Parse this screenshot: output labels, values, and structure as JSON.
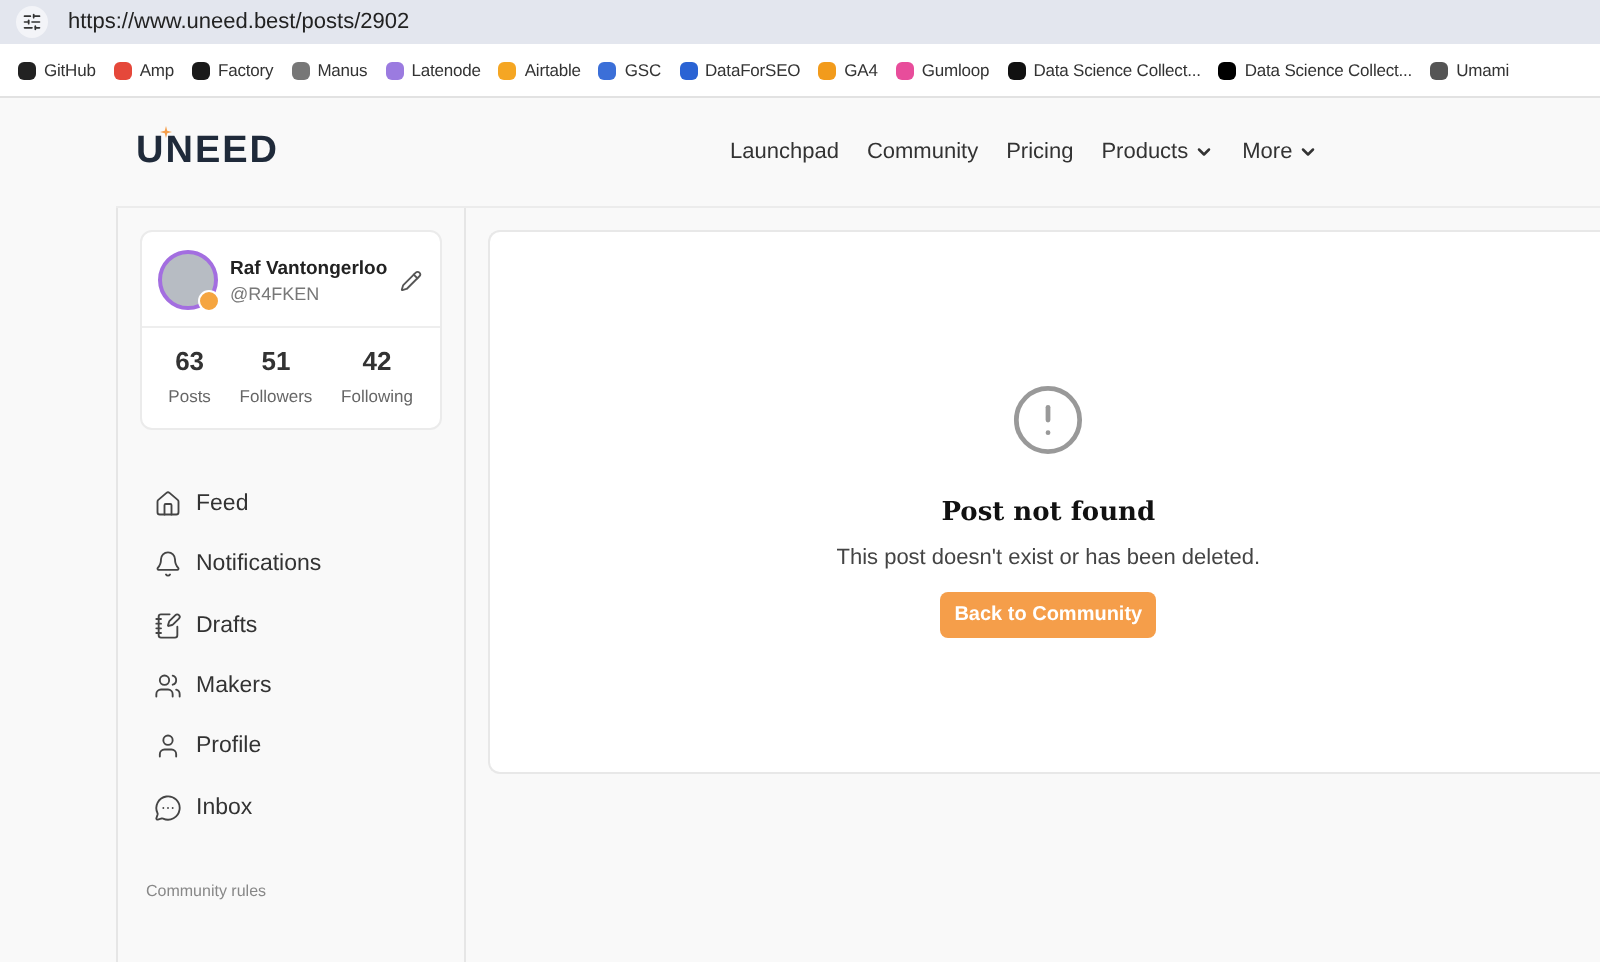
{
  "browser": {
    "url": "https://www.uneed.best/posts/2902"
  },
  "bookmarks": [
    {
      "label": "GitHub",
      "color": "#222222"
    },
    {
      "label": "Amp",
      "color": "#e5483a"
    },
    {
      "label": "Factory",
      "color": "#1a1a1a"
    },
    {
      "label": "Manus",
      "color": "#777777"
    },
    {
      "label": "Latenode",
      "color": "#9b7be0"
    },
    {
      "label": "Airtable",
      "color": "#f5a623"
    },
    {
      "label": "GSC",
      "color": "#3b6fd8"
    },
    {
      "label": "DataForSEO",
      "color": "#2a63d4"
    },
    {
      "label": "GA4",
      "color": "#f29b1c"
    },
    {
      "label": "Gumloop",
      "color": "#e84d9b"
    },
    {
      "label": "Data Science Collect...",
      "color": "#111111"
    },
    {
      "label": "Data Science Collect...",
      "color": "#000000"
    },
    {
      "label": "Umami",
      "color": "#555555"
    }
  ],
  "logo": "UNEED",
  "nav": [
    {
      "label": "Launchpad",
      "dropdown": false
    },
    {
      "label": "Community",
      "dropdown": false
    },
    {
      "label": "Pricing",
      "dropdown": false
    },
    {
      "label": "Products",
      "dropdown": true
    },
    {
      "label": "More",
      "dropdown": true
    }
  ],
  "profile": {
    "name": "Raf Vantongerloo",
    "handle": "@R4FKEN",
    "stats": [
      {
        "value": "63",
        "label": "Posts"
      },
      {
        "value": "51",
        "label": "Followers"
      },
      {
        "value": "42",
        "label": "Following"
      }
    ]
  },
  "sidebar": {
    "items": [
      {
        "label": "Feed",
        "kind": "home"
      },
      {
        "label": "Notifications",
        "kind": "bell"
      },
      {
        "label": "Drafts",
        "kind": "drafts"
      },
      {
        "label": "Makers",
        "kind": "users"
      },
      {
        "label": "Profile",
        "kind": "user"
      },
      {
        "label": "Inbox",
        "kind": "chat"
      }
    ],
    "footer_link": "Community rules"
  },
  "message": {
    "title": "Post not found",
    "text": "This post doesn't exist or has been deleted.",
    "button": "Back to Community"
  }
}
